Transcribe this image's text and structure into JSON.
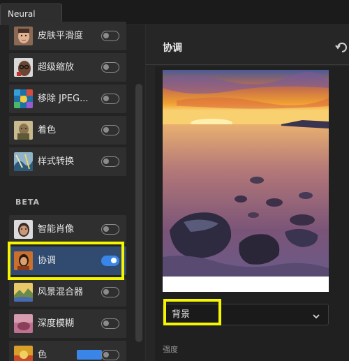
{
  "tab": {
    "label": "Neural Filters"
  },
  "filters": [
    {
      "name": "皮肤平滑度",
      "enabled": false,
      "icon": "face-portrait-icon"
    },
    {
      "name": "超级缩放",
      "enabled": false,
      "icon": "zoom-face-icon"
    },
    {
      "name": "移除 JPEG...",
      "enabled": false,
      "icon": "jpeg-artifacts-icon"
    },
    {
      "name": "着色",
      "enabled": false,
      "icon": "colorize-photo-icon"
    },
    {
      "name": "样式转换",
      "enabled": false,
      "icon": "style-transfer-icon"
    }
  ],
  "beta_label": "BETA",
  "beta_filters": [
    {
      "name": "智能肖像",
      "enabled": false,
      "icon": "smart-portrait-icon"
    },
    {
      "name": "协调",
      "enabled": true,
      "selected": true,
      "icon": "harmonization-icon"
    },
    {
      "name": "风景混合器",
      "enabled": false,
      "icon": "landscape-mixer-icon"
    },
    {
      "name": "深度模糊",
      "enabled": false,
      "icon": "depth-blur-icon"
    },
    {
      "name": "色",
      "enabled": false,
      "icon": "color-transfer-icon",
      "badge": true
    }
  ],
  "panel": {
    "title": "协调",
    "dropdown_value": "背景",
    "strength_label": "强度"
  },
  "colors": {
    "accent": "#3a86e8",
    "highlight": "#f5f500",
    "selected_bg": "#314a70"
  }
}
